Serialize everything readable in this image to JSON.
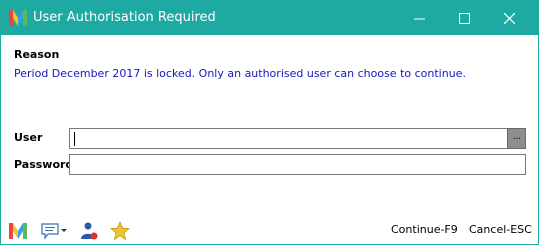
{
  "window": {
    "title": "User Authorisation Required",
    "controls": {
      "minimize": "minimize",
      "maximize": "maximize",
      "close": "close"
    }
  },
  "reason": {
    "label": "Reason",
    "text": "Period December 2017 is locked. Only an authorised user can choose to continue."
  },
  "form": {
    "user_label": "User",
    "user_value": "",
    "lookup_label": "···",
    "password_label": "Password",
    "password_value": ""
  },
  "footer": {
    "icons": [
      "app-logo-icon",
      "message-icon",
      "user-icon",
      "star-icon"
    ],
    "continue_label": "Continue-F9",
    "cancel_label": "Cancel-ESC"
  },
  "colors": {
    "titlebar": "#1fa9a3",
    "reason_text": "#1616c8"
  }
}
